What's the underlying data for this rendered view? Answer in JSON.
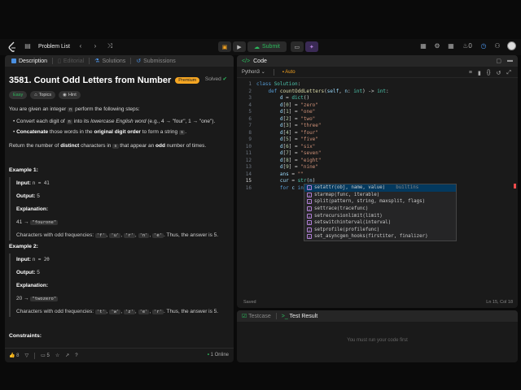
{
  "topbar": {
    "problem_list": "Problem List",
    "submit": "Submit"
  },
  "left": {
    "tabs": [
      "Description",
      "Editorial",
      "Solutions",
      "Submissions"
    ],
    "title": "3581. Count Odd Letters from Number",
    "premium": "Premium",
    "solved": "Solved",
    "tags": [
      "Easy",
      "Topics",
      "Hint"
    ],
    "intro_a": "You are given an integer ",
    "intro_code": "n",
    "intro_b": " perform the following steps:",
    "b1_a": "Convert each digit of ",
    "b1_code": "n",
    "b1_b": " into its ",
    "b1_em": "lowercase English word",
    "b1_c": " (e.g., 4 → \"four\", 1 → \"one\").",
    "b2_bold": "Concatenate",
    "b2_a": " those words in the ",
    "b2_bold2": "original digit order",
    "b2_b": " to form a string ",
    "b2_code": "s",
    "b2_c": ".",
    "ret_a": "Return the number of ",
    "ret_bold": "distinct",
    "ret_b": " characters in ",
    "ret_code": "s",
    "ret_c": " that appear an ",
    "ret_bold2": "odd",
    "ret_d": " number of times.",
    "ex1": {
      "title": "Example 1:",
      "input_label": "Input:",
      "input": "n = 41",
      "output_label": "Output:",
      "output": "5",
      "expl_label": "Explanation:",
      "expl_a": "41 → ",
      "expl_code": "\"fourone\"",
      "chars_a": "Characters with odd frequencies: ",
      "chars": [
        "'f'",
        "'u'",
        "'r'",
        "'n'",
        "'e'"
      ],
      "chars_b": ". Thus, the answer is 5."
    },
    "ex2": {
      "title": "Example 2:",
      "input_label": "Input:",
      "input": "n = 20",
      "output_label": "Output:",
      "output": "5",
      "expl_label": "Explanation:",
      "expl_a": "20 → ",
      "expl_code": "\"twozero\"",
      "chars_a": "Characters with odd frequencies: ",
      "chars": [
        "'t'",
        "'w'",
        "'z'",
        "'e'",
        "'r'"
      ],
      "chars_b": ". Thus, the answer is 5."
    },
    "constraints": "Constraints:",
    "bottom": {
      "likes": "8",
      "comments": "5",
      "online": "1 Online"
    }
  },
  "code": {
    "tab": "Code",
    "lang": "Python3",
    "auto": "Auto",
    "status_left": "Saved",
    "status_right": "Ln 15, Col 18",
    "autocomplete": [
      {
        "label": "setattr(obj, name, value)",
        "source": "builtins"
      },
      {
        "label": "starmap(func, iterable)",
        "source": ""
      },
      {
        "label": "split(pattern, string, maxsplit, flags)",
        "source": ""
      },
      {
        "label": "settrace(tracefunc)",
        "source": ""
      },
      {
        "label": "setrecursionlimit(limit)",
        "source": ""
      },
      {
        "label": "setswitchinterval(interval)",
        "source": ""
      },
      {
        "label": "setprofile(profilefunc)",
        "source": ""
      },
      {
        "label": "set_asyncgen_hooks(firstiter, finalizer)",
        "source": ""
      }
    ]
  },
  "test": {
    "tabs": [
      "Testcase",
      "Test Result"
    ],
    "message": "You must run your code first"
  }
}
